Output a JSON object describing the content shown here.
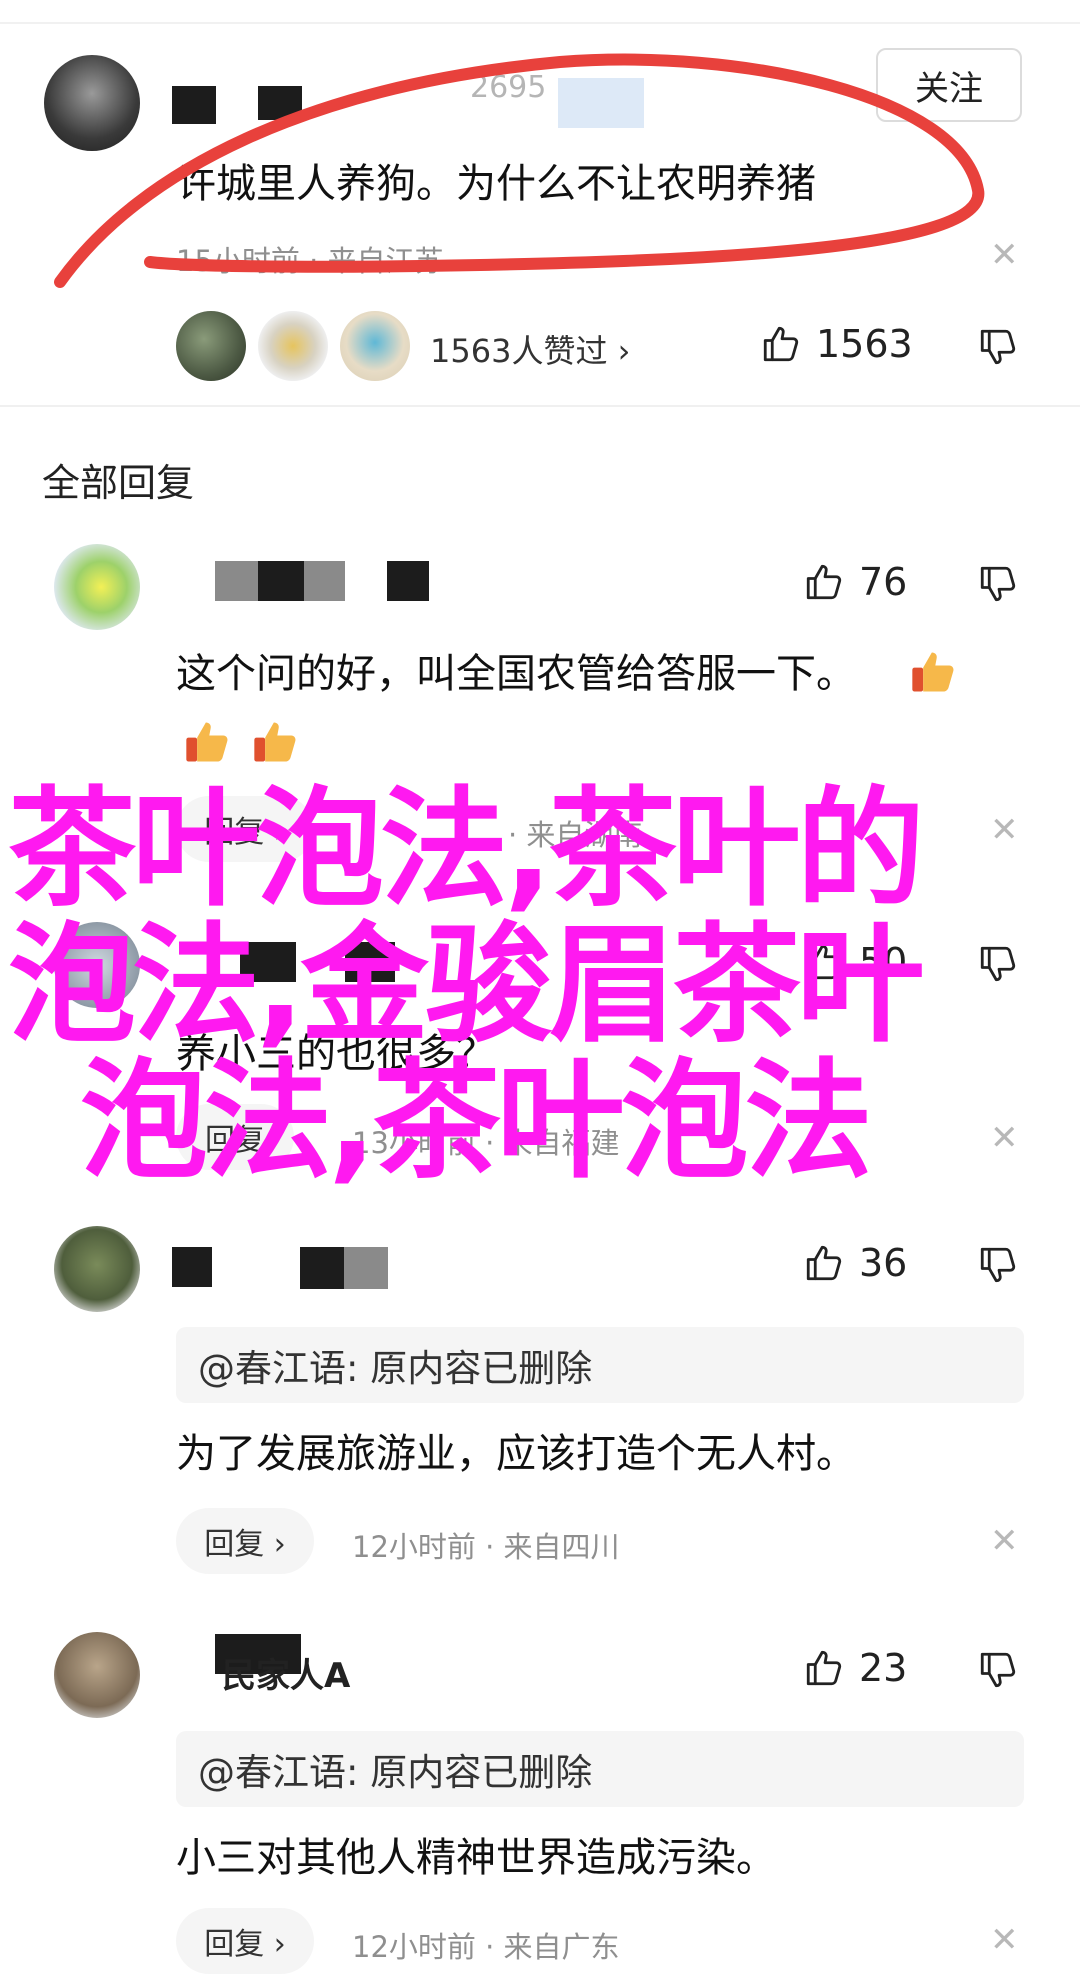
{
  "top_comment": {
    "follow_label": "关注",
    "partial_username": "2695",
    "text": "许城里人养狗。为什么不让农明养猪",
    "meta": "15小时前 · 来自江苏",
    "likers_label": "1563人赞过 ›",
    "like_count": "1563"
  },
  "section_title": "全部回复",
  "replies": [
    {
      "like_count": "76",
      "text": "这个问的好，叫全国农管给答服一下。",
      "meta_reply": "回复 ›",
      "meta_time": "· 来自湖南"
    },
    {
      "like_count": "50",
      "text": "养小三的也很多？",
      "meta_reply": "回复",
      "meta_time": "13小时前 · 来自福建"
    },
    {
      "like_count": "36",
      "quote": "@春江语: 原内容已删除",
      "text": "为了发展旅游业，应该打造个无人村。",
      "meta_reply": "回复 ›",
      "meta_time": "12小时前 · 来自四川"
    },
    {
      "username_partial": "民家人A",
      "like_count": "23",
      "quote": "@春江语: 原内容已删除",
      "text": "小三对其他人精神世界造成污染。",
      "meta_reply": "回复 ›",
      "meta_time": "12小时前 · 来自广东"
    }
  ],
  "overlay": {
    "line1": "茶叶泡法,茶叶的",
    "line2": "泡法,金骏眉茶叶",
    "line3": "泡法,茶叶泡法"
  },
  "colors": {
    "overlay": "#ff19f0",
    "annotation_red": "#e8413c"
  }
}
